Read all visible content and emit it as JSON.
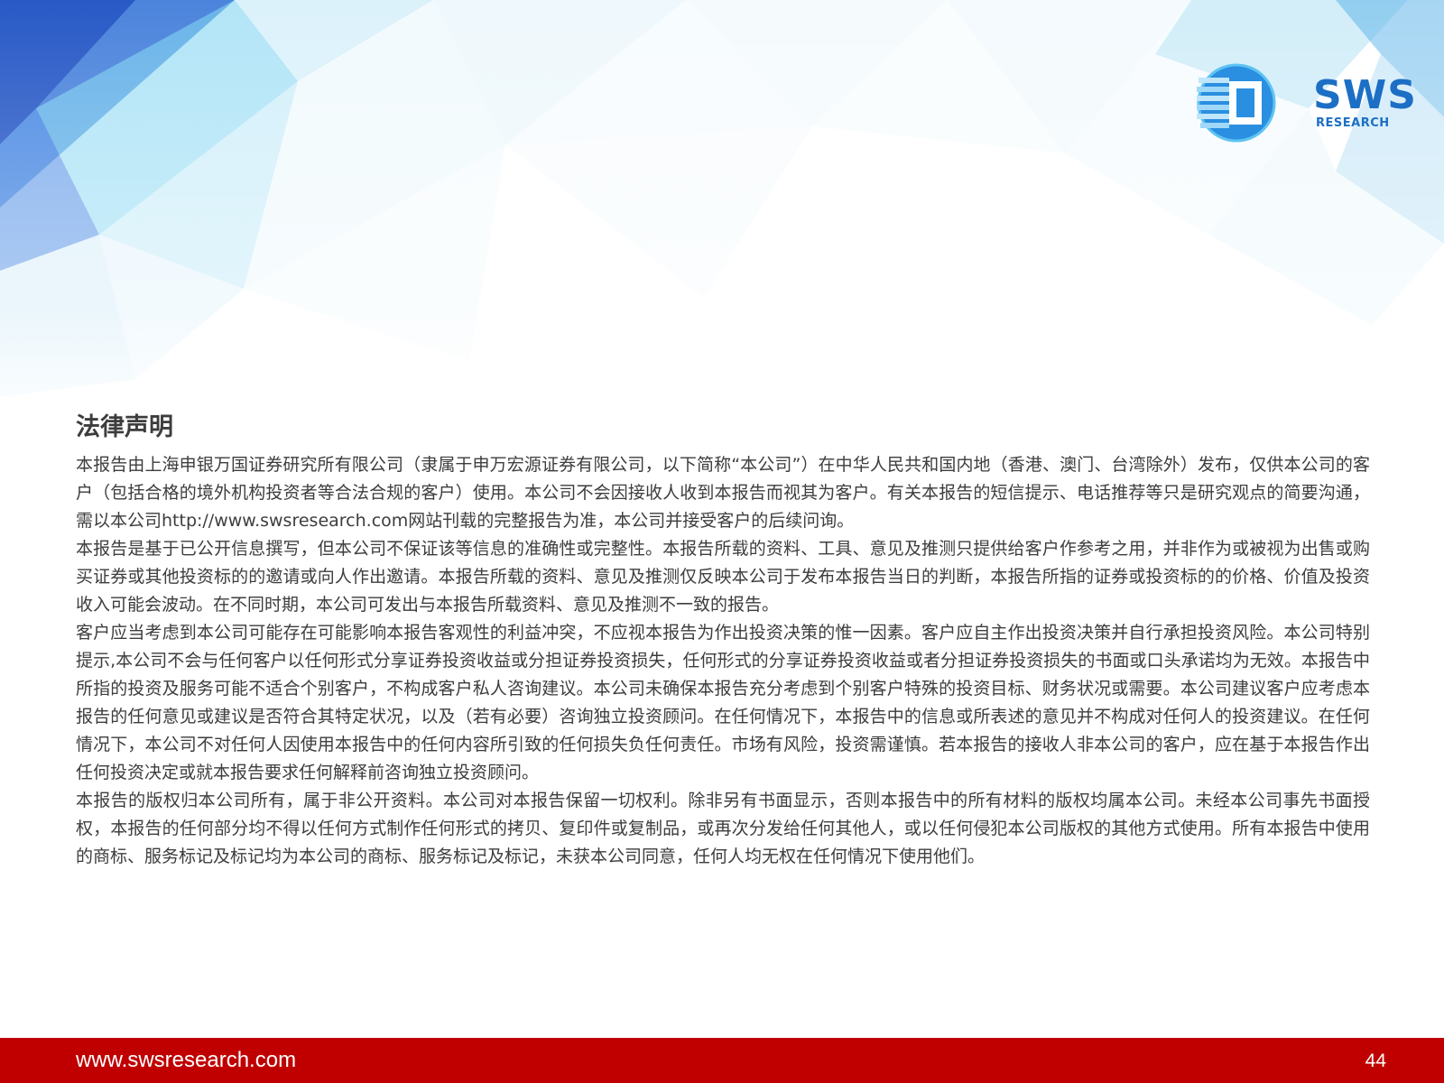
{
  "header": {
    "logo_text": "SWS",
    "logo_subtext": "RESEARCH"
  },
  "section": {
    "title": "法律声明",
    "paragraphs": [
      "本报告由上海申银万国证券研究所有限公司（隶属于申万宏源证券有限公司，以下简称“本公司”）在中华人民共和国内地（香港、澳门、台湾除外）发布，仅供本公司的客户（包括合格的境外机构投资者等合法合规的客户）使用。本公司不会因接收人收到本报告而视其为客户。有关本报告的短信提示、电话推荐等只是研究观点的简要沟通，需以本公司http://www.swsresearch.com网站刊载的完整报告为准，本公司并接受客户的后续问询。",
      "本报告是基于已公开信息撰写，但本公司不保证该等信息的准确性或完整性。本报告所载的资料、工具、意见及推测只提供给客户作参考之用，并非作为或被视为出售或购买证券或其他投资标的的邀请或向人作出邀请。本报告所载的资料、意见及推测仅反映本公司于发布本报告当日的判断，本报告所指的证券或投资标的的价格、价值及投资收入可能会波动。在不同时期，本公司可发出与本报告所载资料、意见及推测不一致的报告。",
      "客户应当考虑到本公司可能存在可能影响本报告客观性的利益冲突，不应视本报告为作出投资决策的惟一因素。客户应自主作出投资决策并自行承担投资风险。本公司特别提示,本公司不会与任何客户以任何形式分享证券投资收益或分担证券投资损失，任何形式的分享证券投资收益或者分担证券投资损失的书面或口头承诺均为无效。本报告中所指的投资及服务可能不适合个别客户，不构成客户私人咨询建议。本公司未确保本报告充分考虑到个别客户特殊的投资目标、财务状况或需要。本公司建议客户应考虑本报告的任何意见或建议是否符合其特定状况，以及（若有必要）咨询独立投资顾问。在任何情况下，本报告中的信息或所表述的意见并不构成对任何人的投资建议。在任何情况下，本公司不对任何人因使用本报告中的任何内容所引致的任何损失负任何责任。市场有风险，投资需谨慎。若本报告的接收人非本公司的客户，应在基于本报告作出任何投资决定或就本报告要求任何解释前咨询独立投资顾问。",
      "本报告的版权归本公司所有，属于非公开资料。本公司对本报告保留一切权利。除非另有书面显示，否则本报告中的所有材料的版权均属本公司。未经本公司事先书面授权，本报告的任何部分均不得以任何方式制作任何形式的拷贝、复印件或复制品，或再次分发给任何其他人，或以任何侵犯本公司版权的其他方式使用。所有本报告中使用的商标、服务标记及标记均为本公司的商标、服务标记及标记，未获本公司同意，任何人均无权在任何情况下使用他们。"
    ]
  },
  "footer": {
    "website": "www.swsresearch.com",
    "page_number": "44"
  },
  "colors": {
    "brand_blue": "#1c6fc4",
    "footer_red": "#c00000",
    "text_gray": "#3d3d3d"
  }
}
